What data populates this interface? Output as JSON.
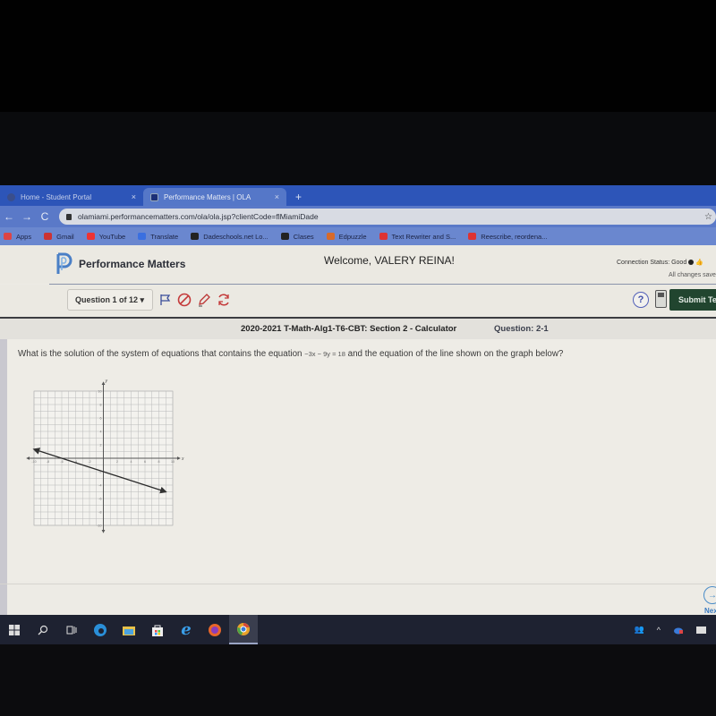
{
  "browser": {
    "tabs": [
      {
        "title": "Home - Student Portal",
        "icon": "globe-icon",
        "active": false
      },
      {
        "title": "Performance Matters | OLA",
        "icon": "pm-page-icon",
        "active": true
      }
    ],
    "new_tab_label": "+",
    "close_label": "×",
    "url": "olamiami.performancematters.com/ola/ola.jsp?clientCode=flMiamiDade",
    "nav": {
      "back": "←",
      "forward": "→",
      "reload": "C"
    },
    "bookmarks": [
      {
        "label": "Apps",
        "icon": "apps-grid-icon",
        "color": "#d44"
      },
      {
        "label": "Gmail",
        "icon": "gmail-icon",
        "color": "#c33"
      },
      {
        "label": "YouTube",
        "icon": "youtube-icon",
        "color": "#e33"
      },
      {
        "label": "Translate",
        "icon": "translate-icon",
        "color": "#3a6fe0"
      },
      {
        "label": "Dadeschools.net Lo...",
        "icon": "globe-icon",
        "color": "#222"
      },
      {
        "label": "Clases",
        "icon": "classroom-icon",
        "color": "#222"
      },
      {
        "label": "Edpuzzle",
        "icon": "edpuzzle-icon",
        "color": "#d76a2a"
      },
      {
        "label": "Text Rewriter and S...",
        "icon": "rewriter-icon",
        "color": "#d33"
      },
      {
        "label": "Reescribe, reordena...",
        "icon": "rewriter-icon",
        "color": "#d33"
      }
    ]
  },
  "header": {
    "brand": "Performance Matters",
    "welcome": "Welcome, VALERY REINA!",
    "connection_status": "Connection Status: Good",
    "saved_status": "All changes saved"
  },
  "toolbar": {
    "question_selector": "Question 1 of 12 ▾",
    "icons": [
      "flag-icon",
      "eliminate-icon",
      "highlighter-icon",
      "reset-icon"
    ],
    "help_label": "?",
    "submit_label": "Submit Test"
  },
  "section": {
    "test_title": "2020-2021 T-Math-Alg1-T6-CBT: Section 2 - Calculator",
    "question_number": "Question: 2-1"
  },
  "question": {
    "text_before": "What is the solution of the system of equations that contains the equation ",
    "equation": "−3x − 9y = 18",
    "text_after": " and the equation of the line shown on the graph below?"
  },
  "chart_data": {
    "type": "line",
    "title": "",
    "xlabel": "x",
    "ylabel": "y",
    "xlim": [
      -10,
      10
    ],
    "ylim": [
      -10,
      10
    ],
    "grid": true,
    "x_ticks": [
      -10,
      -8,
      -6,
      -4,
      -2,
      2,
      4,
      6,
      8,
      10
    ],
    "y_ticks": [
      10,
      8,
      6,
      4,
      2,
      -2,
      -4,
      -6,
      -8,
      -10
    ],
    "series": [
      {
        "name": "line",
        "points": [
          [
            -10,
            1.33
          ],
          [
            -6,
            0
          ],
          [
            0,
            -2
          ],
          [
            9,
            -5
          ]
        ],
        "arrows": "both"
      }
    ]
  },
  "footer": {
    "next_label": "Next",
    "next_icon": "→"
  },
  "taskbar": {
    "items": [
      "windows-start-icon",
      "search-icon",
      "task-view-icon",
      "edge-icon",
      "file-explorer-icon",
      "store-icon",
      "ie-icon",
      "firefox-icon",
      "chrome-icon"
    ],
    "tray": [
      "people-icon",
      "chevron-up-icon",
      "onedrive-icon",
      "battery-icon"
    ]
  }
}
